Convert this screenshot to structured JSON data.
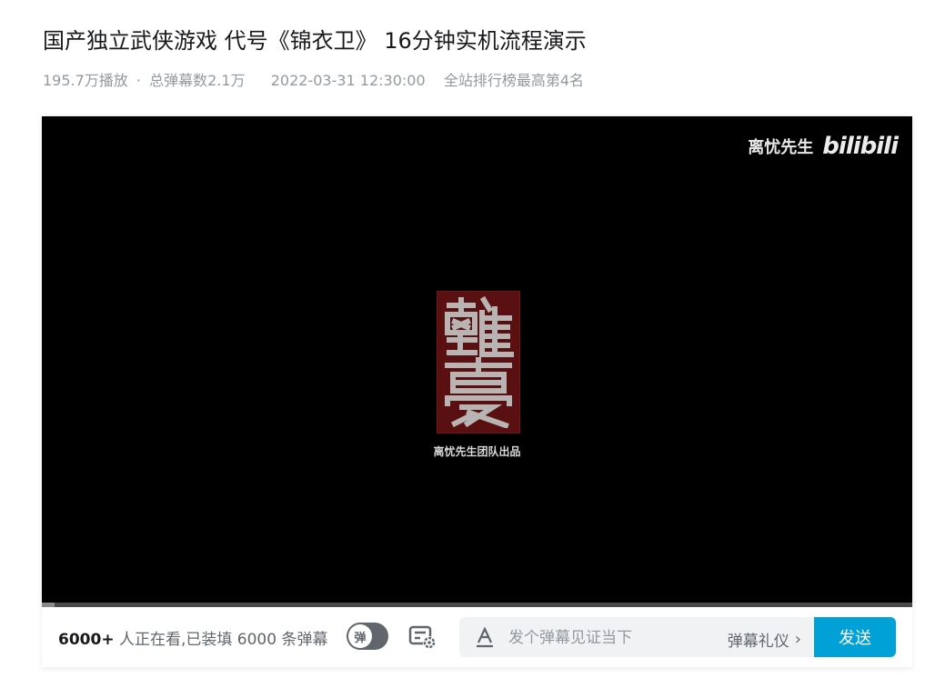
{
  "video": {
    "title": "国产独立武侠游戏 代号《锦衣卫》 16分钟实机流程演示",
    "views": "195.7万播放",
    "separator": "·",
    "danmaku_total": "总弹幕数2.1万",
    "date": "2022-03-31 12:30:00",
    "rank": "全站排行榜最高第4名"
  },
  "player": {
    "watermark_author": "离忧先生",
    "watermark_logo": "bilibili",
    "seal_text": "離憂",
    "studio_credit": "离忧先生团队出品",
    "progress": 0.015
  },
  "bottom_bar": {
    "viewers_count": "6000+",
    "viewers_text": " 人正在看,已装填 6000 条弹幕",
    "toggle_label": "弹",
    "input_placeholder": "发个弹幕见证当下",
    "etiquette_label": "弹幕礼仪",
    "send_label": "发送"
  },
  "colors": {
    "accent": "#00a1d6",
    "seal": "#5a0f10"
  }
}
